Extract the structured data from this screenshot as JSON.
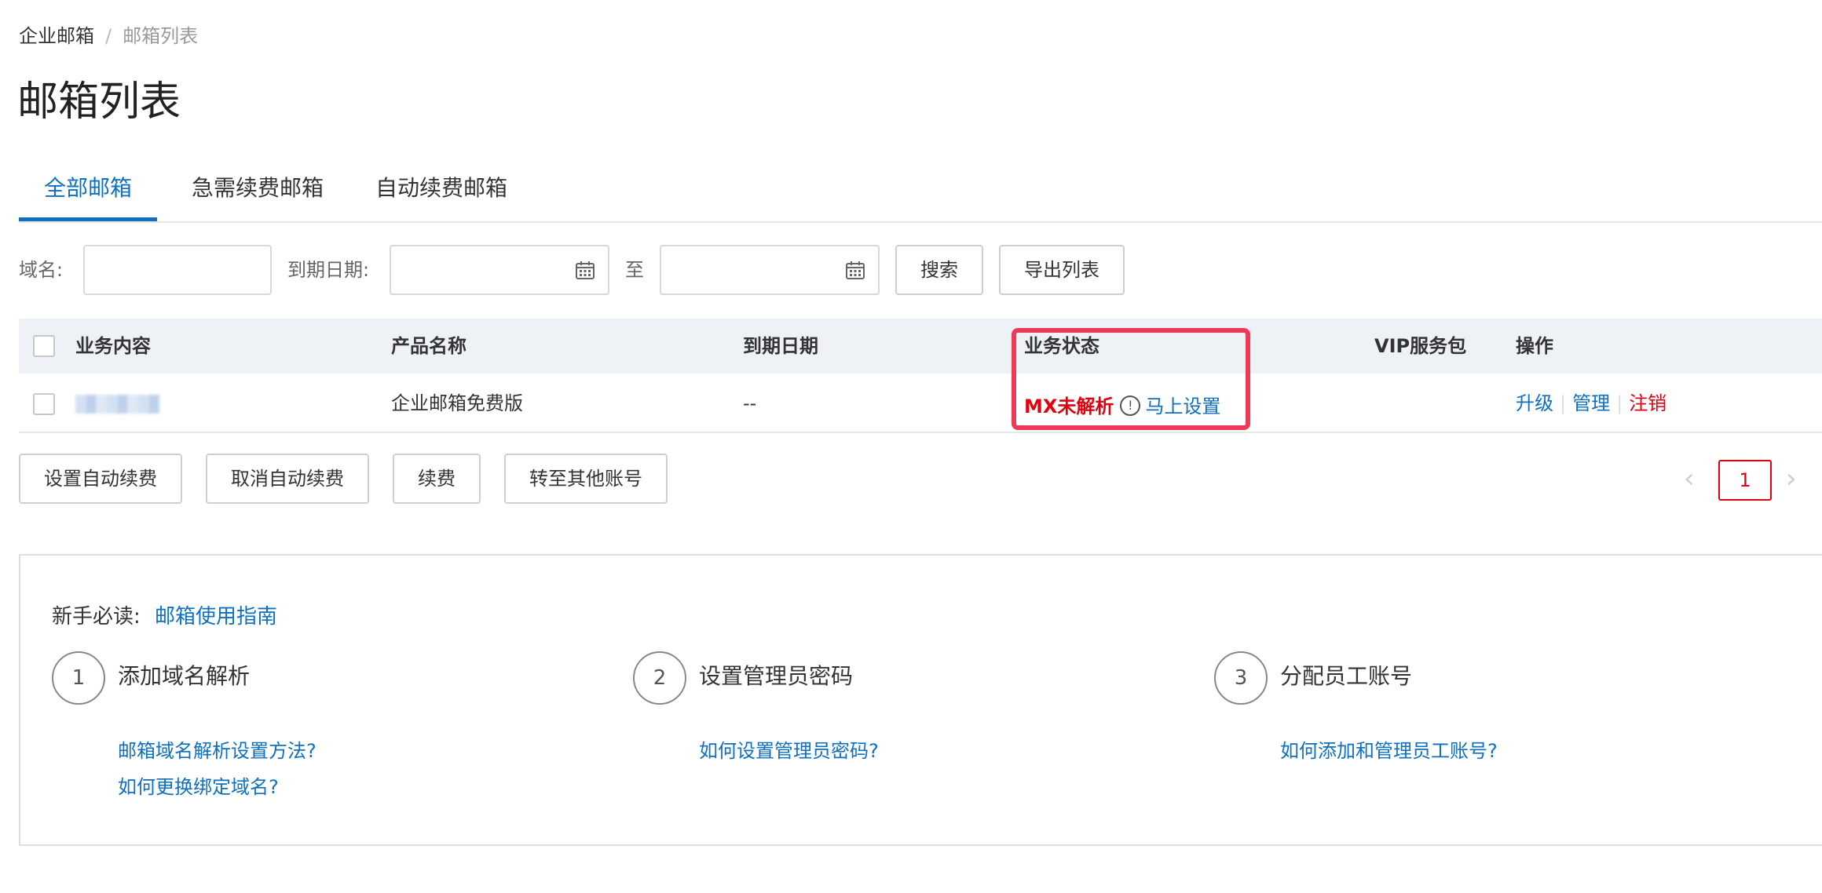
{
  "breadcrumb": {
    "root": "企业邮箱",
    "separator": "/",
    "current": "邮箱列表"
  },
  "page": {
    "title": "邮箱列表"
  },
  "tabs": [
    {
      "label": "全部邮箱",
      "active": true
    },
    {
      "label": "急需续费邮箱",
      "active": false
    },
    {
      "label": "自动续费邮箱",
      "active": false
    }
  ],
  "filters": {
    "domain_label": "域名:",
    "domain_value": "",
    "expire_label": "到期日期:",
    "expire_from": "",
    "to_label": "至",
    "expire_to": "",
    "search_button": "搜索",
    "export_button": "导出列表"
  },
  "table": {
    "columns": [
      "业务内容",
      "产品名称",
      "到期日期",
      "业务状态",
      "VIP服务包",
      "操作"
    ],
    "rows": [
      {
        "business_content": "",
        "product_name": "企业邮箱免费版",
        "expire_date": "--",
        "status": "MX未解析",
        "status_action": "马上设置",
        "vip_package": "",
        "actions": [
          "升级",
          "管理",
          "注销"
        ]
      }
    ]
  },
  "bulk_actions": [
    "设置自动续费",
    "取消自动续费",
    "续费",
    "转至其他账号"
  ],
  "pagination": {
    "current_page": "1",
    "prev": "‹",
    "next": "›"
  },
  "guide": {
    "label": "新手必读:",
    "link": "邮箱使用指南",
    "steps": [
      {
        "number": "1",
        "title": "添加域名解析",
        "links": [
          "邮箱域名解析设置方法?",
          "如何更换绑定域名?"
        ]
      },
      {
        "number": "2",
        "title": "设置管理员密码",
        "links": [
          "如何设置管理员密码?"
        ]
      },
      {
        "number": "3",
        "title": "分配员工账号",
        "links": [
          "如何添加和管理员工账号?"
        ]
      }
    ]
  },
  "colors": {
    "accent": "#0f6fc0",
    "danger": "#e0000f",
    "highlight": "#ee3a57",
    "header_bg": "#eef2f7"
  }
}
